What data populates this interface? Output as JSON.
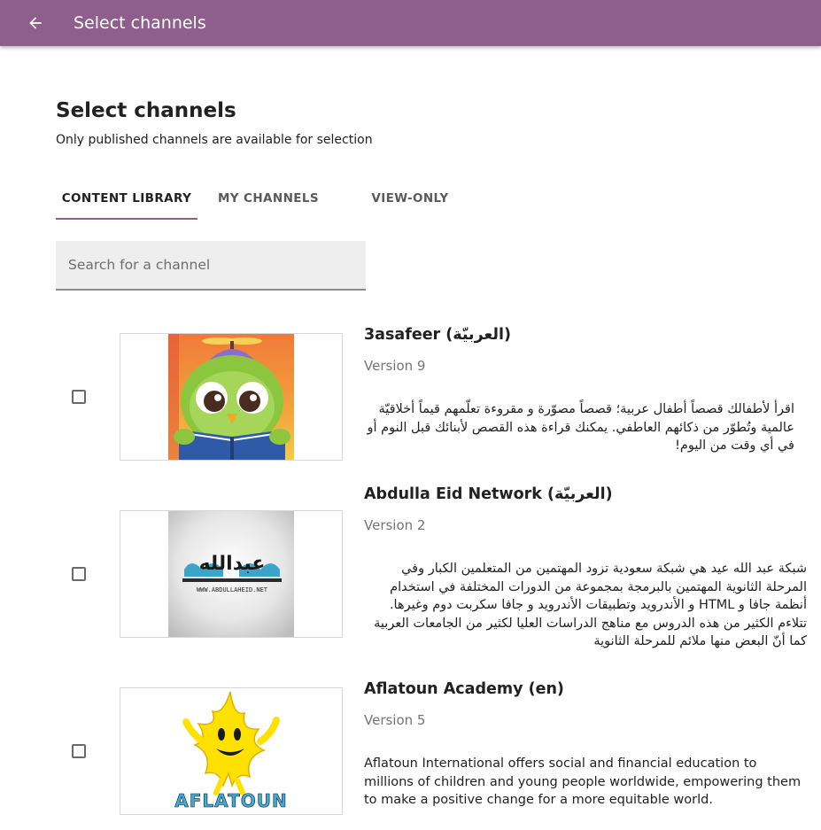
{
  "appbar": {
    "title": "Select channels"
  },
  "page": {
    "heading": "Select channels",
    "subheading": "Only published channels are available for selection"
  },
  "tabs": [
    {
      "label": "CONTENT LIBRARY",
      "active": true
    },
    {
      "label": "MY CHANNELS",
      "active": false
    },
    {
      "label": "VIEW-ONLY",
      "active": false
    }
  ],
  "search": {
    "placeholder": "Search for a channel",
    "value": ""
  },
  "channels": [
    {
      "title": "3asafeer (العربيّة)",
      "version": "Version 9",
      "description": "اقرأ لأطفالك قصصاً أطفال عربية؛ قصصاً مصوّرة و مقروءة تعلّمهم قيماً أخلاقيّة عالمية وتُطوّر من ذكائهم العاطفي. يمكنك قراءة هذه القصص لأبنائك قبل النوم أو في أي وقت من اليوم!",
      "checked": false,
      "thumbnail": "owl-reading-book"
    },
    {
      "title": "Abdulla Eid Network (العربيّة)",
      "version": "Version 2",
      "description": "شبكة عبد الله عيد هي شبكة سعودية تزود المهتمين من المتعلمين الكبار وفي المرحلة الثانوية المهتمين بالبرمجة بمجموعة من الدورات المختلفة في استخدام أنظمة جافا و HTML و الأندرويد وتطبيقات الأندرويد و جافا سكربت دوم وغيرها. تتلاءم الكثير من هذه الدروس مع مناهج الدراسات العليا لكثير من الجامعات العربية كما أنّ البعض منها ملائم للمرحلة الثانوية",
      "checked": false,
      "thumbnail": "abdullaeid-logo",
      "logo_text": "عبدالله",
      "logo_url": "WWW.ABDULLAHEID.NET"
    },
    {
      "title": "Aflatoun Academy (en)",
      "version": "Version 5",
      "description": "Aflatoun International offers social and financial education to millions of children and young people worldwide, empowering them to make a positive change for a more equitable world.",
      "checked": false,
      "thumbnail": "aflatoun-flame-mascot",
      "logo_text": "AFLATOUN"
    }
  ]
}
